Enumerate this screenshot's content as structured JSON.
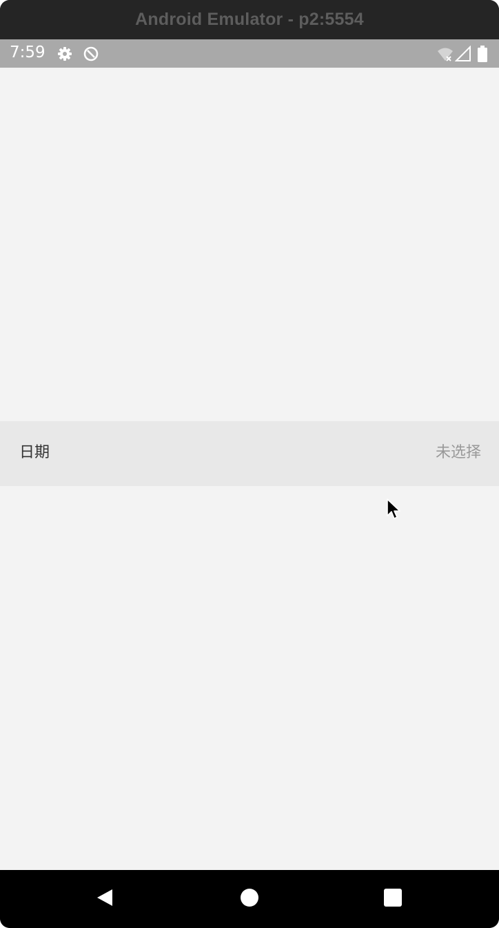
{
  "window": {
    "title": "Android Emulator - p2:5554"
  },
  "status_bar": {
    "time": "7:59",
    "icons": [
      "gear-icon",
      "data-saver-icon",
      "wifi-off-icon",
      "signal-icon",
      "battery-icon"
    ]
  },
  "list": {
    "rows": [
      {
        "label": "日期",
        "value": "未选择"
      }
    ]
  },
  "nav_bar": {
    "buttons": [
      "back-icon",
      "home-icon",
      "recents-icon"
    ]
  },
  "colors": {
    "title_bar_bg": "#252525",
    "status_bar_bg": "#a9a9a9",
    "screen_bg": "#f3f3f3",
    "row_bg": "#e8e8e8",
    "label_text": "#333333",
    "placeholder_text": "#999999",
    "nav_bar_bg": "#000000"
  }
}
